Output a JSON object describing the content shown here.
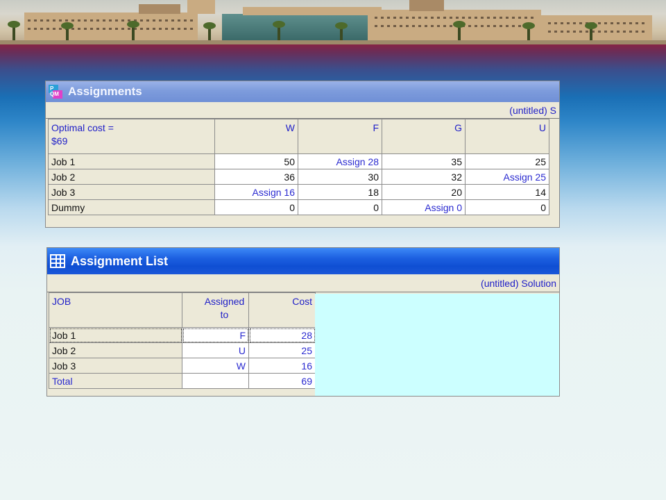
{
  "assignments_window": {
    "title": "Assignments",
    "solution_title": "(untitled) S",
    "headers": [
      "Optimal cost =\n$69",
      "W",
      "F",
      "G",
      "U"
    ],
    "rows": [
      {
        "label": "Job 1",
        "cells": [
          "50",
          "Assign 28",
          "35",
          "25"
        ]
      },
      {
        "label": "Job 2",
        "cells": [
          "36",
          "30",
          "32",
          "Assign 25"
        ]
      },
      {
        "label": "Job 3",
        "cells": [
          "Assign 16",
          "18",
          "20",
          "14"
        ]
      },
      {
        "label": "Dummy",
        "cells": [
          "0",
          "0",
          "Assign 0",
          "0"
        ]
      }
    ]
  },
  "assignment_list_window": {
    "title": "Assignment List",
    "solution_title": "(untitled) Solution",
    "headers": [
      "JOB",
      "Assigned\nto",
      "Cost"
    ],
    "rows": [
      {
        "job": "Job 1",
        "assigned": "F",
        "cost": "28"
      },
      {
        "job": "Job 2",
        "assigned": "U",
        "cost": "25"
      },
      {
        "job": "Job 3",
        "assigned": "W",
        "cost": "16"
      },
      {
        "job": "Total",
        "assigned": "",
        "cost": "69"
      }
    ]
  },
  "colors": {
    "link_blue": "#2a2ad0",
    "panel": "#ece9d8",
    "cyan_area": "#ccffff",
    "title_blue": "#1c5fe0"
  }
}
